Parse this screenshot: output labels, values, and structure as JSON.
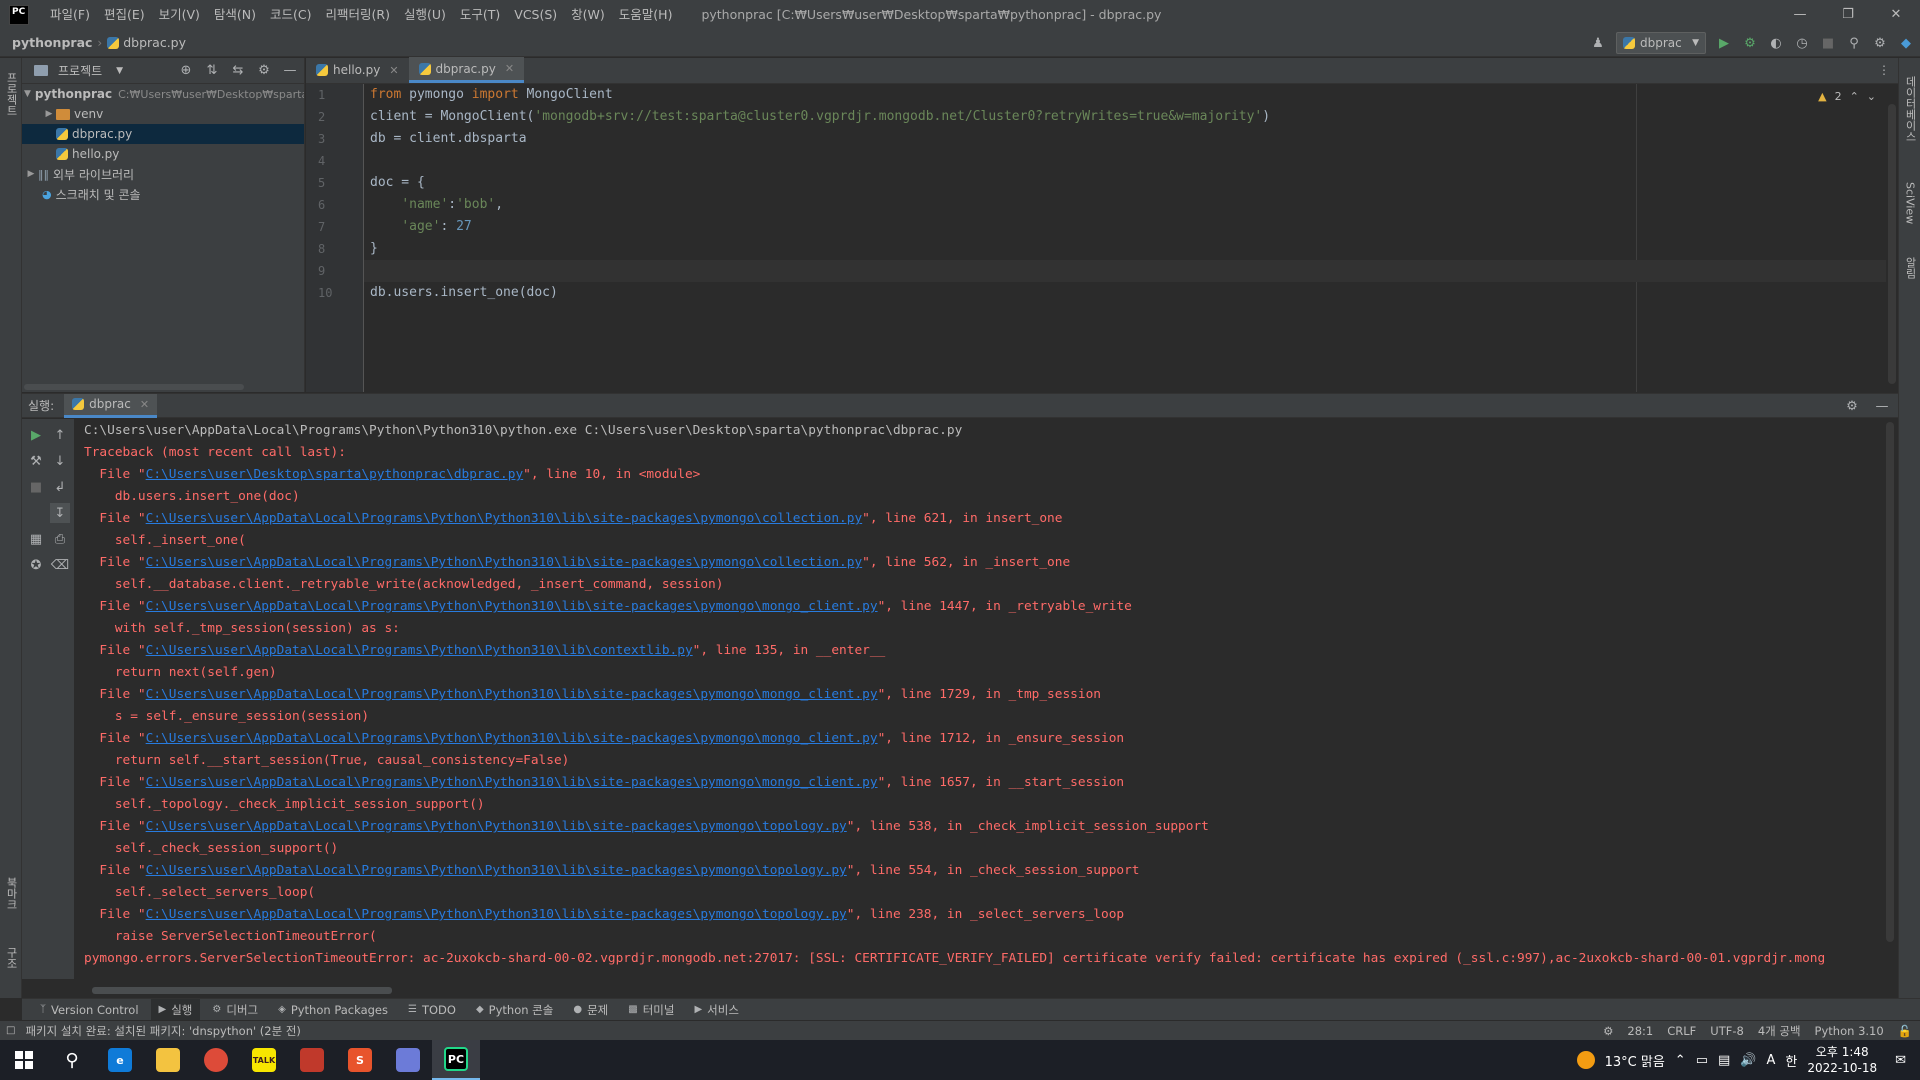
{
  "titlebar": {
    "logo": "PC",
    "menu": [
      "파일(F)",
      "편집(E)",
      "보기(V)",
      "탐색(N)",
      "코드(C)",
      "리팩터링(R)",
      "실행(U)",
      "도구(T)",
      "VCS(S)",
      "창(W)",
      "도움말(H)"
    ],
    "window_title": "pythonprac [C:₩Users₩user₩Desktop₩sparta₩pythonprac] - dbprac.py"
  },
  "navbar": {
    "project": "pythonprac",
    "file": "dbprac.py",
    "run_config": "dbprac"
  },
  "sidebar": {
    "left_tabs": [
      "프로젝트",
      "북마크",
      "구조"
    ],
    "right_tabs": [
      "데이터베이스",
      "SciView",
      "알림"
    ]
  },
  "project_panel": {
    "title": "프로젝트",
    "tree": [
      {
        "label": "pythonprac",
        "path": "C:₩Users₩user₩Desktop₩sparta",
        "type": "folder",
        "expanded": true,
        "depth": 0
      },
      {
        "label": "venv",
        "type": "folder-orange",
        "expanded": false,
        "depth": 1
      },
      {
        "label": "dbprac.py",
        "type": "py",
        "depth": 1,
        "selected": true
      },
      {
        "label": "hello.py",
        "type": "py",
        "depth": 1
      },
      {
        "label": "외부 라이브러리",
        "type": "lib",
        "expanded": false,
        "depth": 0
      },
      {
        "label": "스크래치 및 콘솔",
        "type": "scratch",
        "depth": 0
      }
    ]
  },
  "editor": {
    "tabs": [
      {
        "label": "hello.py",
        "active": false
      },
      {
        "label": "dbprac.py",
        "active": true
      }
    ],
    "warnings": "2",
    "line_numbers": [
      "1",
      "2",
      "3",
      "4",
      "5",
      "6",
      "7",
      "8",
      "9",
      "10"
    ],
    "current_line": 9
  },
  "run_panel": {
    "label": "실행:",
    "tab": "dbprac",
    "command": "C:\\Users\\user\\AppData\\Local\\Programs\\Python\\Python310\\python.exe C:\\Users\\user\\Desktop\\sparta\\pythonprac\\dbprac.py",
    "traceback_header": "Traceback (most recent call last):",
    "frames": [
      {
        "file": "C:\\Users\\user\\Desktop\\sparta\\pythonprac\\dbprac.py",
        "where": "\", line 10, in <module>",
        "code": "db.users.insert_one(doc)"
      },
      {
        "file": "C:\\Users\\user\\AppData\\Local\\Programs\\Python\\Python310\\lib\\site-packages\\pymongo\\collection.py",
        "where": "\", line 621, in insert_one",
        "code": "self._insert_one("
      },
      {
        "file": "C:\\Users\\user\\AppData\\Local\\Programs\\Python\\Python310\\lib\\site-packages\\pymongo\\collection.py",
        "where": "\", line 562, in _insert_one",
        "code": "self.__database.client._retryable_write(acknowledged, _insert_command, session)"
      },
      {
        "file": "C:\\Users\\user\\AppData\\Local\\Programs\\Python\\Python310\\lib\\site-packages\\pymongo\\mongo_client.py",
        "where": "\", line 1447, in _retryable_write",
        "code": "with self._tmp_session(session) as s:"
      },
      {
        "file": "C:\\Users\\user\\AppData\\Local\\Programs\\Python\\Python310\\lib\\contextlib.py",
        "where": "\", line 135, in __enter__",
        "code": "return next(self.gen)"
      },
      {
        "file": "C:\\Users\\user\\AppData\\Local\\Programs\\Python\\Python310\\lib\\site-packages\\pymongo\\mongo_client.py",
        "where": "\", line 1729, in _tmp_session",
        "code": "s = self._ensure_session(session)"
      },
      {
        "file": "C:\\Users\\user\\AppData\\Local\\Programs\\Python\\Python310\\lib\\site-packages\\pymongo\\mongo_client.py",
        "where": "\", line 1712, in _ensure_session",
        "code": "return self.__start_session(True, causal_consistency=False)"
      },
      {
        "file": "C:\\Users\\user\\AppData\\Local\\Programs\\Python\\Python310\\lib\\site-packages\\pymongo\\mongo_client.py",
        "where": "\", line 1657, in __start_session",
        "code": "self._topology._check_implicit_session_support()"
      },
      {
        "file": "C:\\Users\\user\\AppData\\Local\\Programs\\Python\\Python310\\lib\\site-packages\\pymongo\\topology.py",
        "where": "\", line 538, in _check_implicit_session_support",
        "code": "self._check_session_support()"
      },
      {
        "file": "C:\\Users\\user\\AppData\\Local\\Programs\\Python\\Python310\\lib\\site-packages\\pymongo\\topology.py",
        "where": "\", line 554, in _check_session_support",
        "code": "self._select_servers_loop("
      },
      {
        "file": "C:\\Users\\user\\AppData\\Local\\Programs\\Python\\Python310\\lib\\site-packages\\pymongo\\topology.py",
        "where": "\", line 238, in _select_servers_loop",
        "code": "raise ServerSelectionTimeoutError("
      }
    ],
    "error": "pymongo.errors.ServerSelectionTimeoutError: ac-2uxokcb-shard-00-02.vgprdjr.mongodb.net:27017: [SSL: CERTIFICATE_VERIFY_FAILED] certificate verify failed: certificate has expired (_ssl.c:997),ac-2uxokcb-shard-00-01.vgprdjr.mong"
  },
  "tool_tabs": [
    "Version Control",
    "실행",
    "디버그",
    "Python Packages",
    "TODO",
    "Python 콘솔",
    "문제",
    "터미널",
    "서비스"
  ],
  "statusbar": {
    "message": "패키지 설치 완료: 설치된 패키지: 'dnspython' (2분 전)",
    "position": "28:1",
    "line_sep": "CRLF",
    "encoding": "UTF-8",
    "indent": "4개 공백",
    "interpreter": "Python 3.10"
  },
  "taskbar": {
    "apps": [
      {
        "name": "edge",
        "color": "#0f7bd8",
        "glyph": "e"
      },
      {
        "name": "explorer",
        "color": "#f3c340",
        "glyph": ""
      },
      {
        "name": "chrome",
        "color": "#dd4b39",
        "glyph": ""
      },
      {
        "name": "kakaotalk",
        "color": "#f7e600",
        "glyph": "TALK"
      },
      {
        "name": "app-red",
        "color": "#c0392b",
        "glyph": ""
      },
      {
        "name": "app-s",
        "color": "#e8542c",
        "glyph": "S"
      },
      {
        "name": "app-globe",
        "color": "#6c7bd8",
        "glyph": ""
      },
      {
        "name": "pycharm",
        "color": "#21d789",
        "glyph": "PC"
      }
    ],
    "weather": "13°C 맑음",
    "ime": "A",
    "time": "오후 1:48",
    "date": "2022-10-18"
  }
}
